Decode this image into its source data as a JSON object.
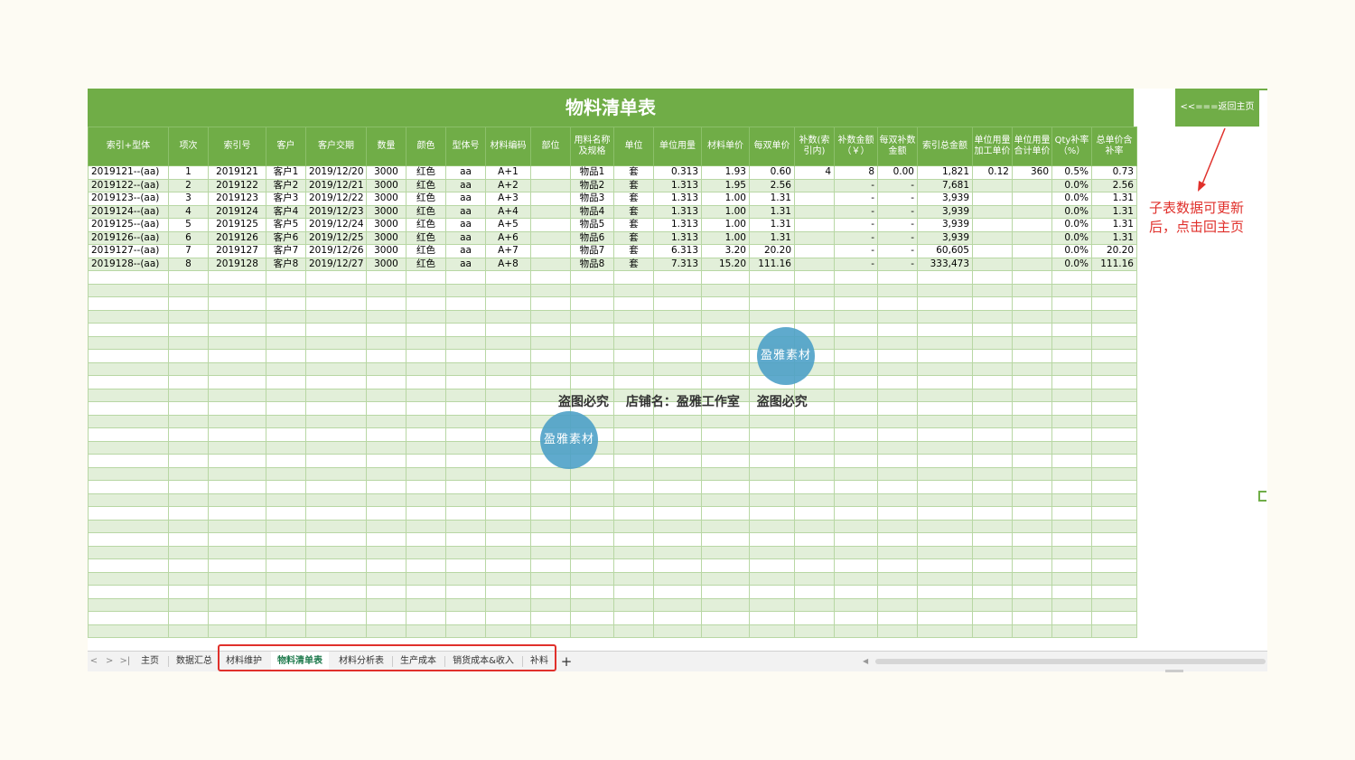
{
  "sheet": {
    "title": "物料清单表",
    "headers": [
      "索引+型体",
      "项次",
      "索引号",
      "客户",
      "客户交期",
      "数量",
      "颜色",
      "型体号",
      "材料编码",
      "部位",
      "用料名称及规格",
      "单位",
      "单位用量",
      "材料单价",
      "每双单价",
      "补数(索引内)",
      "补数金额（￥）",
      "每双补数金额",
      "索引总金额",
      "单位用量加工单价",
      "单位用量合计单价",
      "Qty补率（%）",
      "总单价含补率"
    ],
    "rows": [
      [
        "2019121--(aa)",
        "1",
        "2019121",
        "客户1",
        "2019/12/20",
        "3000",
        "红色",
        "aa",
        "A+1",
        "",
        "物品1",
        "套",
        "0.313",
        "1.93",
        "0.60",
        "4",
        "8",
        "0.00",
        "1,821",
        "0.12",
        "360",
        "0.5%",
        "0.73"
      ],
      [
        "2019122--(aa)",
        "2",
        "2019122",
        "客户2",
        "2019/12/21",
        "3000",
        "红色",
        "aa",
        "A+2",
        "",
        "物品2",
        "套",
        "1.313",
        "1.95",
        "2.56",
        "",
        "-",
        "-",
        "7,681",
        "",
        "",
        "0.0%",
        "2.56"
      ],
      [
        "2019123--(aa)",
        "3",
        "2019123",
        "客户3",
        "2019/12/22",
        "3000",
        "红色",
        "aa",
        "A+3",
        "",
        "物品3",
        "套",
        "1.313",
        "1.00",
        "1.31",
        "",
        "-",
        "-",
        "3,939",
        "",
        "",
        "0.0%",
        "1.31"
      ],
      [
        "2019124--(aa)",
        "4",
        "2019124",
        "客户4",
        "2019/12/23",
        "3000",
        "红色",
        "aa",
        "A+4",
        "",
        "物品4",
        "套",
        "1.313",
        "1.00",
        "1.31",
        "",
        "-",
        "-",
        "3,939",
        "",
        "",
        "0.0%",
        "1.31"
      ],
      [
        "2019125--(aa)",
        "5",
        "2019125",
        "客户5",
        "2019/12/24",
        "3000",
        "红色",
        "aa",
        "A+5",
        "",
        "物品5",
        "套",
        "1.313",
        "1.00",
        "1.31",
        "",
        "-",
        "-",
        "3,939",
        "",
        "",
        "0.0%",
        "1.31"
      ],
      [
        "2019126--(aa)",
        "6",
        "2019126",
        "客户6",
        "2019/12/25",
        "3000",
        "红色",
        "aa",
        "A+6",
        "",
        "物品6",
        "套",
        "1.313",
        "1.00",
        "1.31",
        "",
        "-",
        "-",
        "3,939",
        "",
        "",
        "0.0%",
        "1.31"
      ],
      [
        "2019127--(aa)",
        "7",
        "2019127",
        "客户7",
        "2019/12/26",
        "3000",
        "红色",
        "aa",
        "A+7",
        "",
        "物品7",
        "套",
        "6.313",
        "3.20",
        "20.20",
        "",
        "-",
        "-",
        "60,605",
        "",
        "",
        "0.0%",
        "20.20"
      ],
      [
        "2019128--(aa)",
        "8",
        "2019128",
        "客户8",
        "2019/12/27",
        "3000",
        "红色",
        "aa",
        "A+8",
        "",
        "物品8",
        "套",
        "7.313",
        "15.20",
        "111.16",
        "",
        "-",
        "-",
        "333,473",
        "",
        "",
        "0.0%",
        "111.16"
      ]
    ]
  },
  "back_button": {
    "label": "<<===返回主页"
  },
  "annotation": {
    "line1": "子表数据可更新",
    "line2": "后，点击回主页"
  },
  "watermark": {
    "badge": "盈雅素材",
    "notice_left": "盗图必究",
    "notice_shop": "店铺名：盈雅工作室",
    "notice_right": "盗图必究"
  },
  "tabs": {
    "nav": [
      "<",
      ">",
      ">|"
    ],
    "items": [
      "主页",
      "数据汇总",
      "材料维护",
      "物料清单表",
      "材料分析表",
      "生产成本",
      "销货成本&收入",
      "补料"
    ],
    "active": "物料清单表",
    "add": "+"
  },
  "colors": {
    "header_green": "#70ad47",
    "band_green": "#e2efd9",
    "annotation_red": "#e0302b",
    "watermark_blue": "#4ea1c8"
  }
}
